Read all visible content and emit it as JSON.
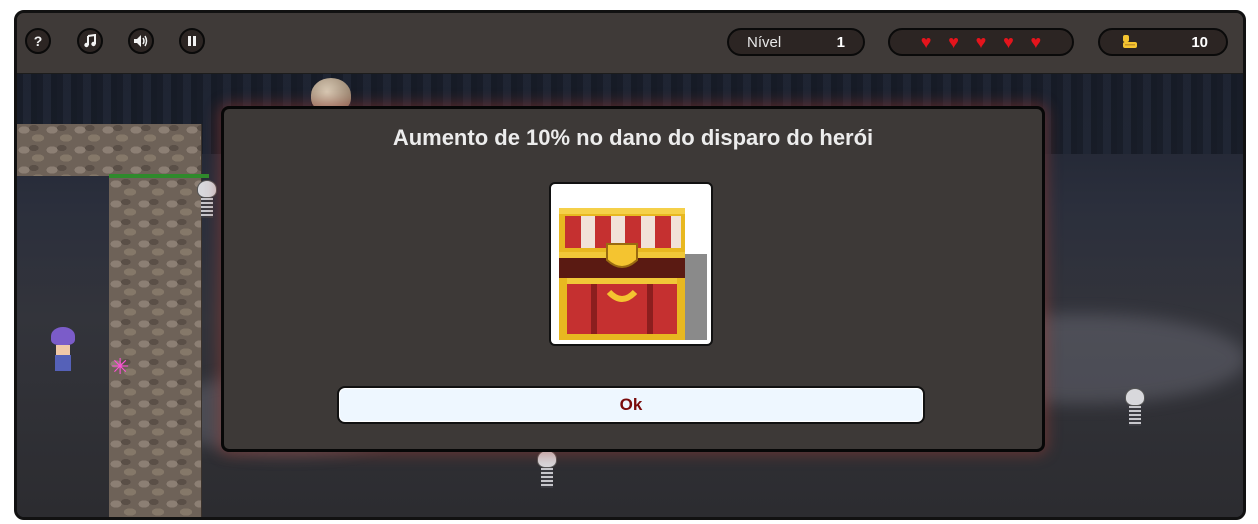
{
  "toolbar": {
    "help_label": "?",
    "music_icon": "music-note-icon",
    "sound_icon": "speaker-volume-icon",
    "pause_icon": "pause-icon"
  },
  "hud": {
    "level_label": "Nível",
    "level_value": "1",
    "lives": 5,
    "coins_icon": "coin-stack-icon",
    "coins_value": "10",
    "heart_color": "#e4141c"
  },
  "dialog": {
    "title": "Aumento de 10% no dano do disparo do herói",
    "reward_icon": "treasure-chest-icon",
    "ok_label": "Ok"
  },
  "colors": {
    "bar_bg": "#3f3a38",
    "modal_bg": "#3d3937",
    "button_bg": "#eef7ff",
    "button_text": "#7a0b0b"
  }
}
